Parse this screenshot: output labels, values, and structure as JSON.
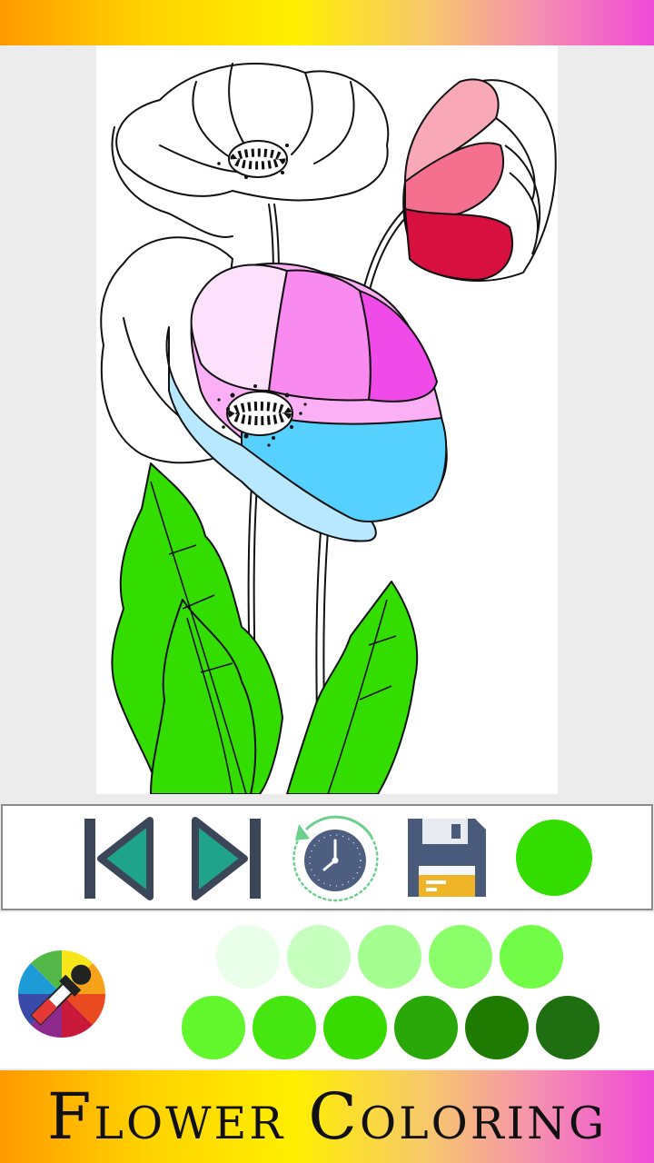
{
  "app": {
    "title": "Flower Coloring"
  },
  "toolbar": {
    "buttons": [
      {
        "name": "undo-button",
        "icon": "skip-previous-icon"
      },
      {
        "name": "redo-button",
        "icon": "skip-next-icon"
      },
      {
        "name": "reset-button",
        "icon": "history-clock-icon"
      },
      {
        "name": "save-button",
        "icon": "floppy-disk-icon"
      }
    ],
    "selected_color": "#33dd00"
  },
  "palette": {
    "picker_icon": "color-wheel-eyedropper-icon",
    "row1": [
      "#eaffea",
      "#c6ffbe",
      "#a4ff90",
      "#8aff6a",
      "#72fc48"
    ],
    "row2": [
      "#62f62c",
      "#46e610",
      "#38db00",
      "#2aa80a",
      "#1e7a00",
      "#1f6f12"
    ]
  },
  "colors": {
    "accent_gradient": [
      "#ff9a00",
      "#ffef00",
      "#f04ad8"
    ],
    "leaf": "#33dd00",
    "icon_dark": "#3b4658",
    "icon_teal": "#1fa38a"
  }
}
